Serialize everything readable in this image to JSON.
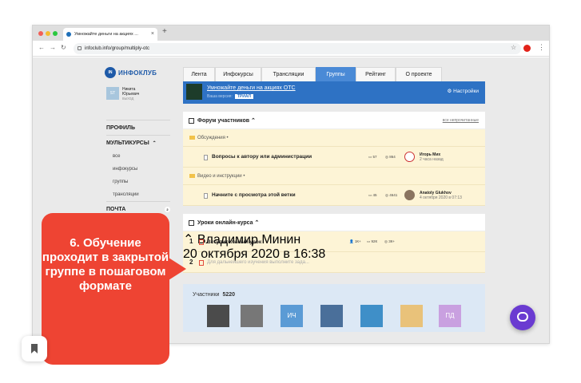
{
  "browser": {
    "tab_title": "Умножайте деньги на акциях ...",
    "tab_close": "×",
    "new_tab": "+",
    "url": "infoclub.info/group/multiply-otc"
  },
  "logo": {
    "text": "ИНФОКЛУБ",
    "mark": "IN"
  },
  "user": {
    "initials": "ST",
    "name_line1": "Никита",
    "name_line2": "Юрьевич",
    "exit": "выход"
  },
  "sidebar": {
    "profile": "ПРОФИЛЬ",
    "multicourses": "МУЛЬТИКУРСЫ",
    "items": [
      "все",
      "инфокурсы",
      "группы",
      "трансляции"
    ],
    "mail": "ПОЧТА",
    "mail_badge": "2"
  },
  "tabs": [
    {
      "label": "Лента"
    },
    {
      "label": "Инфокурсы"
    },
    {
      "label": "Трансляции"
    },
    {
      "label": "Группы"
    },
    {
      "label": "Рейтинг"
    },
    {
      "label": "О проекте"
    }
  ],
  "banner": {
    "title": "Умножайте деньги на акциях ОТС",
    "subtitle": "Ваша версия:",
    "trial": "ТРИАЛ",
    "settings": "Настройки"
  },
  "forum": {
    "title": "Форум участников",
    "unread_link": "все непрочитанные",
    "category1": "Обсуждения",
    "thread1": {
      "title": "Вопросы к автору или администрации",
      "comments": "57",
      "views": "864",
      "author": "Игорь Мих",
      "time": "2 часа назад"
    },
    "category2": "Видео и инструкции",
    "thread2": {
      "title": "Начните с просмотра этой ветки",
      "comments": "45",
      "views": "4641",
      "author": "Anatoly Glukhov",
      "time": "4 октября 2020 в 07:13"
    }
  },
  "lessons": {
    "title": "Уроки онлайн-курса",
    "lesson1": {
      "num": "1",
      "title": "Вступительный урок",
      "students": "1К+",
      "comments": "92К",
      "views": "3К+",
      "author": "Владимир Минин",
      "time": "20 октября 2020 в 16:38"
    },
    "lesson2": {
      "num": "2",
      "placeholder": "Для дальнейшего изучения выполните зада..."
    }
  },
  "members": {
    "label": "Участники",
    "count": "5220",
    "ik": "ИЧ",
    "pd": "ПД"
  },
  "callout": {
    "text": "6. Обучение проходит в закрытой группе в пошаговом формате"
  },
  "colors": {
    "accent": "#4a8ad6",
    "callout": "#ee4433",
    "forum_bg": "#fdf4d6",
    "chat": "#6a3bd1"
  }
}
